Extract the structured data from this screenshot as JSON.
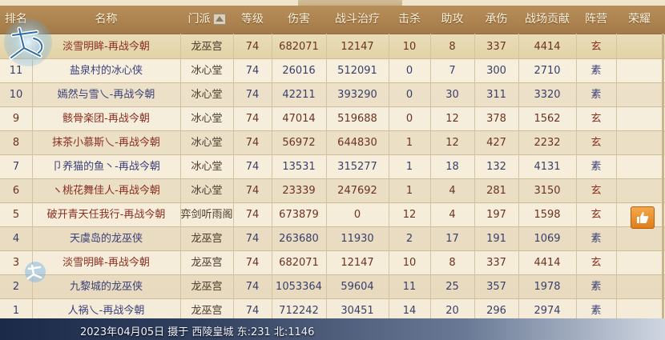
{
  "header": {
    "rank": "排名",
    "name": "名称",
    "faction": "门派",
    "level": "等级",
    "damage": "伤害",
    "heal": "战斗治疗",
    "kills": "击杀",
    "assists": "助攻",
    "taken": "承伤",
    "contribution": "战场贡献",
    "camp": "阵营",
    "honor": "荣耀"
  },
  "rows": [
    {
      "rank": "",
      "name": "淡雪明眸-再战今朝",
      "faction": "龙巫宫",
      "level": "74",
      "damage": "682071",
      "heal": "12147",
      "kills": "10",
      "assists": "8",
      "taken": "337",
      "contribution": "4414",
      "camp": "玄",
      "camp_color": "#8a2e22"
    },
    {
      "rank": "11",
      "name": "盐泉村的冰心侠",
      "faction": "冰心堂",
      "level": "74",
      "damage": "26016",
      "heal": "512091",
      "kills": "0",
      "assists": "7",
      "taken": "300",
      "contribution": "2710",
      "camp": "素",
      "camp_color": "#3a3f7a"
    },
    {
      "rank": "10",
      "name": "嫣然与雪乀-再战今朝",
      "faction": "冰心堂",
      "level": "74",
      "damage": "42211",
      "heal": "393290",
      "kills": "0",
      "assists": "30",
      "taken": "311",
      "contribution": "3320",
      "camp": "素",
      "camp_color": "#3a3f7a"
    },
    {
      "rank": "9",
      "name": "骸骨楽团-再战今朝",
      "faction": "冰心堂",
      "level": "74",
      "damage": "47014",
      "heal": "519688",
      "kills": "0",
      "assists": "12",
      "taken": "378",
      "contribution": "1562",
      "camp": "玄",
      "camp_color": "#8a2e22"
    },
    {
      "rank": "8",
      "name": "抹茶小慕斯乀-再战今朝",
      "faction": "冰心堂",
      "level": "74",
      "damage": "56972",
      "heal": "644830",
      "kills": "1",
      "assists": "12",
      "taken": "427",
      "contribution": "2232",
      "camp": "玄",
      "camp_color": "#8a2e22"
    },
    {
      "rank": "7",
      "name": "卩养猫的鱼丶-再战今朝",
      "faction": "冰心堂",
      "level": "74",
      "damage": "13531",
      "heal": "315277",
      "kills": "1",
      "assists": "18",
      "taken": "132",
      "contribution": "4131",
      "camp": "素",
      "camp_color": "#3a3f7a"
    },
    {
      "rank": "6",
      "name": "ヽ桃花舞佳人-再战今朝",
      "faction": "冰心堂",
      "level": "74",
      "damage": "23339",
      "heal": "247692",
      "kills": "1",
      "assists": "4",
      "taken": "281",
      "contribution": "3150",
      "camp": "玄",
      "camp_color": "#8a2e22"
    },
    {
      "rank": "5",
      "name": "破开青天任我行-再战今朝",
      "faction": "弈剑听雨阁",
      "level": "74",
      "damage": "673879",
      "heal": "0",
      "kills": "12",
      "assists": "4",
      "taken": "197",
      "contribution": "1598",
      "camp": "玄",
      "camp_color": "#8a2e22"
    },
    {
      "rank": "4",
      "name": "天虞岛的龙巫侠",
      "faction": "龙巫宫",
      "level": "74",
      "damage": "263680",
      "heal": "11930",
      "kills": "2",
      "assists": "17",
      "taken": "191",
      "contribution": "1069",
      "camp": "素",
      "camp_color": "#3a3f7a"
    },
    {
      "rank": "3",
      "name": "淡雪明眸-再战今朝",
      "faction": "龙巫宫",
      "level": "74",
      "damage": "682071",
      "heal": "12147",
      "kills": "10",
      "assists": "8",
      "taken": "337",
      "contribution": "4414",
      "camp": "玄",
      "camp_color": "#8a2e22"
    },
    {
      "rank": "2",
      "name": "九黎城的龙巫侠",
      "faction": "龙巫宫",
      "level": "74",
      "damage": "1053364",
      "heal": "59604",
      "kills": "11",
      "assists": "25",
      "taken": "357",
      "contribution": "1978",
      "camp": "素",
      "camp_color": "#3a3f7a"
    },
    {
      "rank": "1",
      "name": "人祸乀-再战今朝",
      "faction": "龙巫宫",
      "level": "74",
      "damage": "712242",
      "heal": "30451",
      "kills": "14",
      "assists": "20",
      "taken": "296",
      "contribution": "2974",
      "camp": "素",
      "camp_color": "#3a3f7a"
    }
  ],
  "like_icon": "thumbs-up-icon",
  "logo_text": "天下",
  "footer": "2023年04月05日  摄于  西陵皇城  东:231  北:1146"
}
